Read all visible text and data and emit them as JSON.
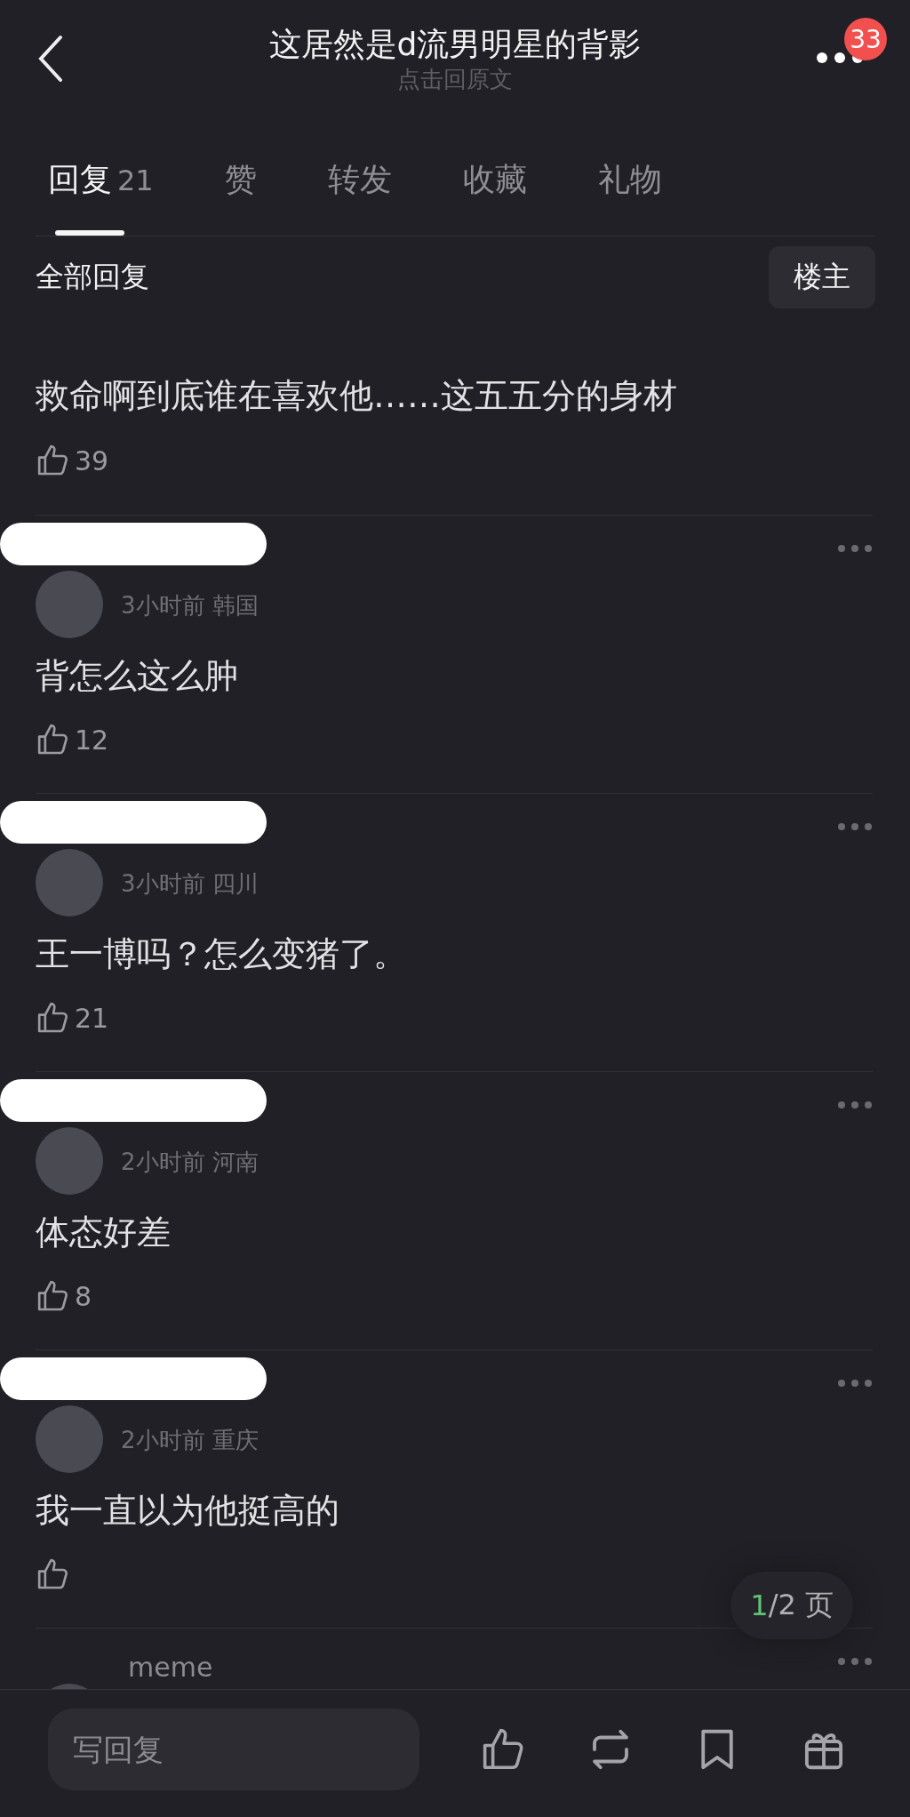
{
  "header": {
    "title": "这居然是d流男明星的背影",
    "subtitle": "点击回原文",
    "badge": "33"
  },
  "tabs": [
    {
      "label": "回复",
      "count": "21",
      "selected": true
    },
    {
      "label": "赞",
      "selected": false
    },
    {
      "label": "转发",
      "selected": false
    },
    {
      "label": "收藏",
      "selected": false
    },
    {
      "label": "礼物",
      "selected": false
    }
  ],
  "section": {
    "title": "全部回复",
    "filter_button": "楼主"
  },
  "comments": [
    {
      "text": "救命啊到底谁在喜欢他……这五五分的身材",
      "likes": "39"
    },
    {
      "name_redacted": true,
      "meta": "3小时前 韩国",
      "text": "背怎么这么肿",
      "likes": "12"
    },
    {
      "name_redacted": true,
      "meta": "3小时前 四川",
      "text": "王一博吗？怎么变猪了。",
      "likes": "21"
    },
    {
      "name_redacted": true,
      "meta": "2小时前 河南",
      "text": "体态好差",
      "likes": "8"
    },
    {
      "name_redacted": true,
      "meta": "2小时前 重庆",
      "text": "我一直以为他挺高的"
    },
    {
      "name_redacted": false,
      "name": "meme"
    }
  ],
  "pager": {
    "current": "1",
    "total": "/2 页"
  },
  "bottom_bar": {
    "placeholder": "写回复"
  }
}
